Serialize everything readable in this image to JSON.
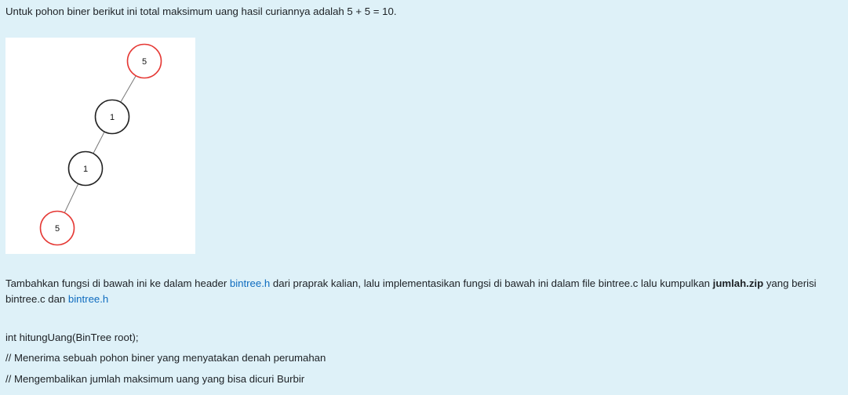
{
  "intro": "Untuk pohon biner berikut ini total maksimum uang hasil curiannya adalah 5 + 5 = 10.",
  "tree": {
    "nodes": [
      {
        "value": "5",
        "highlight": true
      },
      {
        "value": "1",
        "highlight": false
      },
      {
        "value": "1",
        "highlight": false
      },
      {
        "value": "5",
        "highlight": true
      }
    ],
    "colors": {
      "highlight": "#e53935",
      "normal": "#222222",
      "edge": "#777777"
    }
  },
  "para": {
    "t1": "Tambahkan fungsi di bawah ini ke dalam header ",
    "link1": "bintree.h",
    "t2": " dari praprak kalian, lalu implementasikan fungsi di bawah ini dalam file bintree.c lalu kumpulkan ",
    "bold": "jumlah.zip",
    "t3": " yang berisi bintree.c dan ",
    "link2": "bintree.h"
  },
  "code": {
    "line1": "int hitungUang(BinTree root);",
    "line2": "// Menerima sebuah pohon biner yang menyatakan denah perumahan",
    "line3": "// Mengembalikan jumlah maksimum uang yang bisa dicuri Burbir"
  }
}
